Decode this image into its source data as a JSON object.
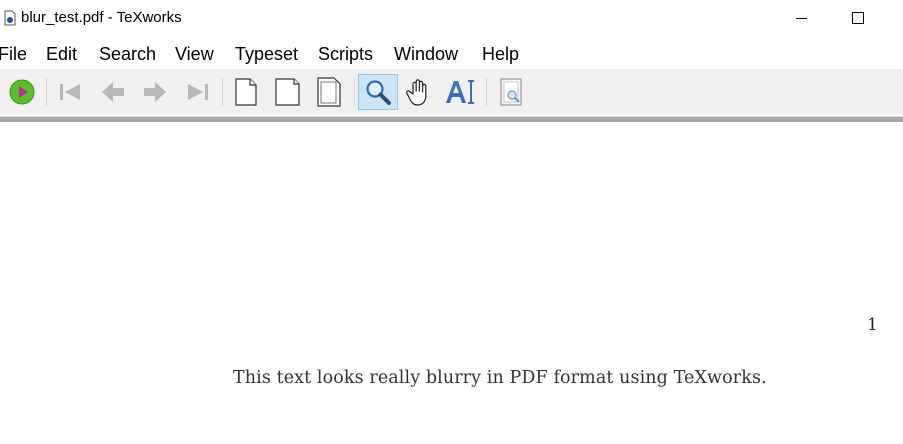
{
  "window": {
    "title": "blur_test.pdf - TeXworks"
  },
  "menu": {
    "items": [
      "File",
      "Edit",
      "Search",
      "View",
      "Typeset",
      "Scripts",
      "Window",
      "Help"
    ]
  },
  "toolbar": {
    "icons": [
      "typeset-run-icon",
      "first-page-icon",
      "previous-page-icon",
      "next-page-icon",
      "last-page-icon",
      "actual-size-icon",
      "fit-width-icon",
      "fit-window-icon",
      "magnify-icon",
      "scroll-hand-icon",
      "select-text-icon",
      "fullscreen-preview-icon"
    ],
    "active_tool": "magnify-icon",
    "accent_color": "#3a8ee6"
  },
  "document": {
    "page_number": "1",
    "body_text": "This text looks really blurry in PDF format using TeXworks."
  }
}
